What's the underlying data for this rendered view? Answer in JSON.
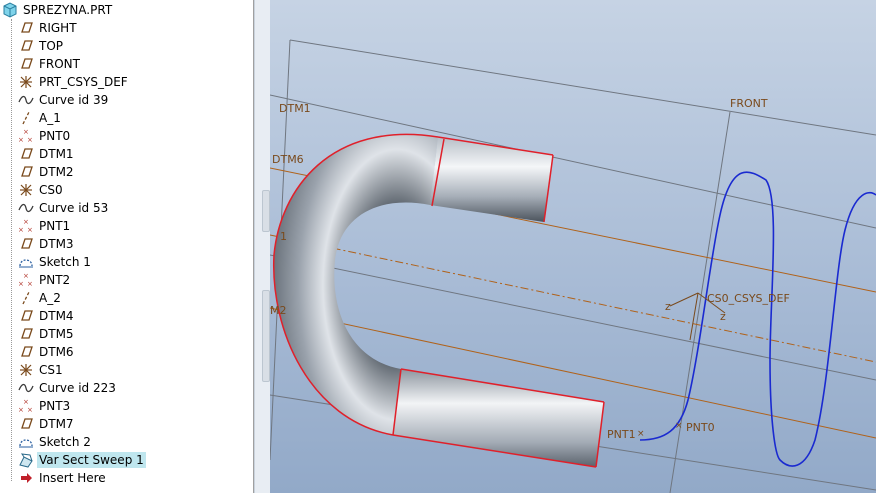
{
  "model_tree": {
    "root": "SPREZYNA.PRT",
    "items": [
      {
        "label": "RIGHT",
        "icon": "datum-plane-icon"
      },
      {
        "label": "TOP",
        "icon": "datum-plane-icon"
      },
      {
        "label": "FRONT",
        "icon": "datum-plane-icon"
      },
      {
        "label": "PRT_CSYS_DEF",
        "icon": "csys-icon"
      },
      {
        "label": "Curve id 39",
        "icon": "curve-icon"
      },
      {
        "label": "A_1",
        "icon": "datum-axis-icon"
      },
      {
        "label": "PNT0",
        "icon": "datum-point-icon"
      },
      {
        "label": "DTM1",
        "icon": "datum-plane-icon"
      },
      {
        "label": "DTM2",
        "icon": "datum-plane-icon"
      },
      {
        "label": "CS0",
        "icon": "csys-icon"
      },
      {
        "label": "Curve id 53",
        "icon": "curve-icon"
      },
      {
        "label": "PNT1",
        "icon": "datum-point-icon"
      },
      {
        "label": "DTM3",
        "icon": "datum-plane-icon"
      },
      {
        "label": "Sketch 1",
        "icon": "sketch-icon"
      },
      {
        "label": "PNT2",
        "icon": "datum-point-icon"
      },
      {
        "label": "A_2",
        "icon": "datum-axis-icon"
      },
      {
        "label": "DTM4",
        "icon": "datum-plane-icon"
      },
      {
        "label": "DTM5",
        "icon": "datum-plane-icon"
      },
      {
        "label": "DTM6",
        "icon": "datum-plane-icon"
      },
      {
        "label": "CS1",
        "icon": "csys-icon"
      },
      {
        "label": "Curve id 223",
        "icon": "curve-icon"
      },
      {
        "label": "PNT3",
        "icon": "datum-point-icon"
      },
      {
        "label": "DTM7",
        "icon": "datum-plane-icon"
      },
      {
        "label": "Sketch 2",
        "icon": "sketch-icon"
      },
      {
        "label": "Var Sect Sweep 1",
        "icon": "sweep-icon",
        "selected": true
      },
      {
        "label": "Insert Here",
        "icon": "insert-arrow-icon"
      }
    ]
  },
  "viewport": {
    "labels": {
      "dtm1": "DTM1",
      "dtm6": "DTM6",
      "front": "FRONT",
      "csys": "CS0_CSYS_DEF",
      "pnt1": "PNT1",
      "pnt0": "PNT0",
      "edge1": "1",
      "edge2": "M2",
      "z1": "z",
      "z2": "z"
    }
  },
  "colors": {
    "selection": "#bfe6ee",
    "datum_label": "#7a4a1c",
    "curve": "#1a2ad0",
    "highlight_edge": "#e0202a",
    "datum_line": "#b0621a"
  }
}
